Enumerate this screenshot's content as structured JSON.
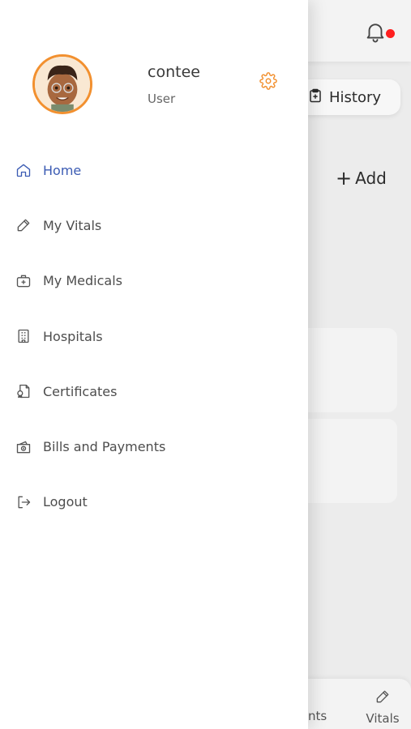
{
  "background": {
    "history_label": "History",
    "add_label": "Add",
    "nav_partial_label": "nts",
    "nav_vitals_label": "Vitals"
  },
  "drawer": {
    "profile": {
      "name": "contee",
      "role": "User"
    },
    "menu": [
      {
        "label": "Home",
        "icon": "home-icon",
        "active": true
      },
      {
        "label": "My Vitals",
        "icon": "pen-icon",
        "active": false
      },
      {
        "label": "My Medicals",
        "icon": "medical-kit-icon",
        "active": false
      },
      {
        "label": "Hospitals",
        "icon": "hospital-building-icon",
        "active": false
      },
      {
        "label": "Certificates",
        "icon": "certificate-icon",
        "active": false
      },
      {
        "label": "Bills and Payments",
        "icon": "wallet-icon",
        "active": false
      },
      {
        "label": "Logout",
        "icon": "logout-icon",
        "active": false
      }
    ]
  },
  "colors": {
    "accent_orange": "#f2902f",
    "active_blue": "#3b5bb3",
    "notification_red": "#ff1f1f"
  }
}
